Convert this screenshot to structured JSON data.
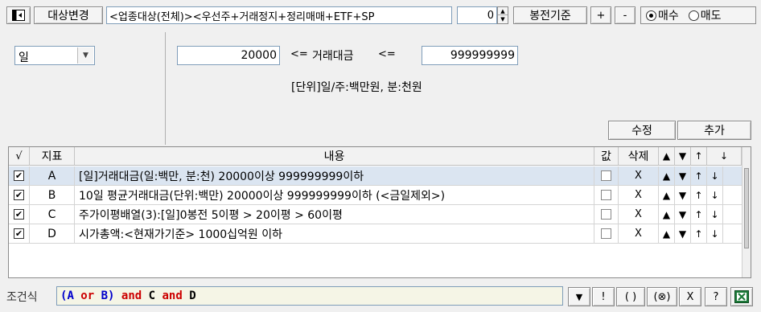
{
  "toolbar": {
    "target_change_label": "대상변경",
    "target_filter_value": "<업종대상(전체)><우선주+거래정지+정리매매+ETF+SP",
    "spinner_value": "0",
    "bong_basis_label": "봉전기준",
    "plus_label": "+",
    "minus_label": "-",
    "buy_label": "매수",
    "sell_label": "매도",
    "buy_selected": true
  },
  "settings": {
    "period_value": "일",
    "min_value": "20000",
    "lte1": "<=",
    "indicator_label": "거래대금",
    "lte2": "<=",
    "max_value": "999999999",
    "unit_note": "[단위]일/주:백만원, 분:천원",
    "modify_label": "수정",
    "add_label": "추가"
  },
  "table": {
    "headers": {
      "check": "√",
      "indicator": "지표",
      "content": "내용",
      "value": "값",
      "delete": "삭제",
      "up_tri": "▲",
      "down_tri": "▼",
      "up_arrow": "↑",
      "down_arrow": "↓"
    },
    "rows": [
      {
        "checked": "✔",
        "id": "A",
        "content": "[일]거래대금(일:백만, 분:천) 20000이상 999999999이하",
        "delete": "X",
        "up_tri": "▲",
        "down_tri": "▼",
        "up_arrow": "↑",
        "down_arrow": "↓"
      },
      {
        "checked": "✔",
        "id": "B",
        "content": "10일 평균거래대금(단위:백만) 20000이상 999999999이하 (<금일제외>)",
        "delete": "X",
        "up_tri": "▲",
        "down_tri": "▼",
        "up_arrow": "↑",
        "down_arrow": "↓"
      },
      {
        "checked": "✔",
        "id": "C",
        "content": "주가이평배열(3):[일]0봉전 5이평 > 20이평 > 60이평",
        "delete": "X",
        "up_tri": "▲",
        "down_tri": "▼",
        "up_arrow": "↑",
        "down_arrow": "↓"
      },
      {
        "checked": "✔",
        "id": "D",
        "content": "시가총액:<현재가기준> 1000십억원 이하",
        "delete": "X",
        "up_tri": "▲",
        "down_tri": "▼",
        "up_arrow": "↑",
        "down_arrow": "↓"
      }
    ]
  },
  "formula": {
    "label": "조건식",
    "tokens": [
      {
        "t": "(",
        "c": "#0000cc"
      },
      {
        "t": "A",
        "c": "#0000cc"
      },
      {
        "t": " or ",
        "c": "#cc0000"
      },
      {
        "t": "B",
        "c": "#0000cc"
      },
      {
        "t": ")",
        "c": "#0000cc"
      },
      {
        "t": " and ",
        "c": "#cc0000"
      },
      {
        "t": "C",
        "c": "#000000"
      },
      {
        "t": " and ",
        "c": "#cc0000"
      },
      {
        "t": "D",
        "c": "#000000"
      }
    ],
    "buttons": {
      "dropdown": "▼",
      "not": "!",
      "paren": "( )",
      "xor": "(⊗)",
      "x": "X",
      "help": "?"
    }
  },
  "colors": {
    "selected_row": "#dbe5f1",
    "excel_green": "#1d7a3a",
    "or_red": "#cc0000",
    "id_blue": "#0000cc"
  }
}
